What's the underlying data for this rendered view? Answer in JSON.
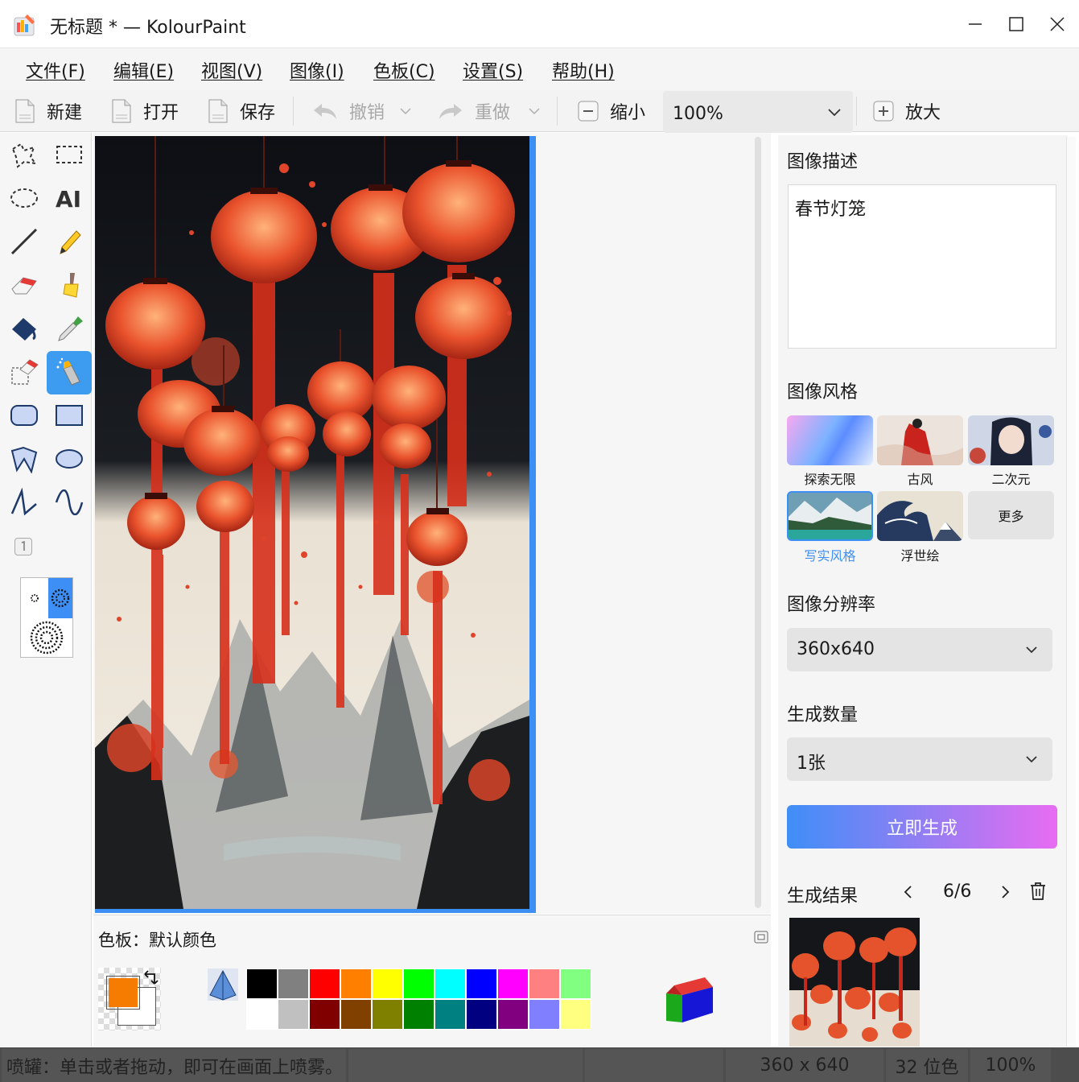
{
  "window": {
    "title": "无标题 * — KolourPaint",
    "controls": {
      "minimize": "minimize-icon",
      "maximize": "maximize-icon",
      "close": "close-icon"
    }
  },
  "menu": [
    {
      "label": "文件(F)"
    },
    {
      "label": "编辑(E)"
    },
    {
      "label": "视图(V)"
    },
    {
      "label": "图像(I)"
    },
    {
      "label": "色板(C)"
    },
    {
      "label": "设置(S)"
    },
    {
      "label": "帮助(H)"
    }
  ],
  "toolbar": {
    "new_label": "新建",
    "open_label": "打开",
    "save_label": "保存",
    "undo_label": "撤销",
    "redo_label": "重做",
    "zoom_out_label": "缩小",
    "zoom_value": "100%",
    "zoom_in_label": "放大"
  },
  "tools": [
    "free-select",
    "rect-select",
    "ellipse-select",
    "text",
    "line",
    "pencil",
    "eraser",
    "brush",
    "flood-fill",
    "color-picker",
    "color-eraser",
    "spraycan",
    "rounded-rect",
    "rectangle",
    "polygon",
    "ellipse",
    "polyline",
    "curve"
  ],
  "active_tool": "spraycan",
  "palette": {
    "title": "色板：默认颜色",
    "foreground": "#f57c00",
    "background": "#ffffff",
    "row1": [
      "#000000",
      "#808080",
      "#ff0000",
      "#ff8000",
      "#ffff00",
      "#00ff00",
      "#00ffff",
      "#0000ff",
      "#ff00ff",
      "#ff8080",
      "#80ff80"
    ],
    "row2": [
      "#ffffff",
      "#c0c0c0",
      "#800000",
      "#804000",
      "#808000",
      "#008000",
      "#008080",
      "#000080",
      "#800080",
      "#8080ff",
      "#ffff80"
    ]
  },
  "ai_panel": {
    "description_label": "图像描述",
    "description_value": "春节灯笼",
    "style_label": "图像风格",
    "styles": [
      {
        "name": "探索无限",
        "selected": false
      },
      {
        "name": "古风",
        "selected": false
      },
      {
        "name": "二次元",
        "selected": false
      },
      {
        "name": "写实风格",
        "selected": true
      },
      {
        "name": "浮世绘",
        "selected": false
      }
    ],
    "more_label": "更多",
    "resolution_label": "图像分辨率",
    "resolution_value": "360x640",
    "count_label": "生成数量",
    "count_value": "1张",
    "generate_label": "立即生成",
    "result_label": "生成结果",
    "result_page": "6/6"
  },
  "status": {
    "message": "喷罐：单击或者拖动，即可在画面上喷雾。",
    "size": "360 x 640",
    "depth": "32 位色",
    "zoom": "100%"
  }
}
